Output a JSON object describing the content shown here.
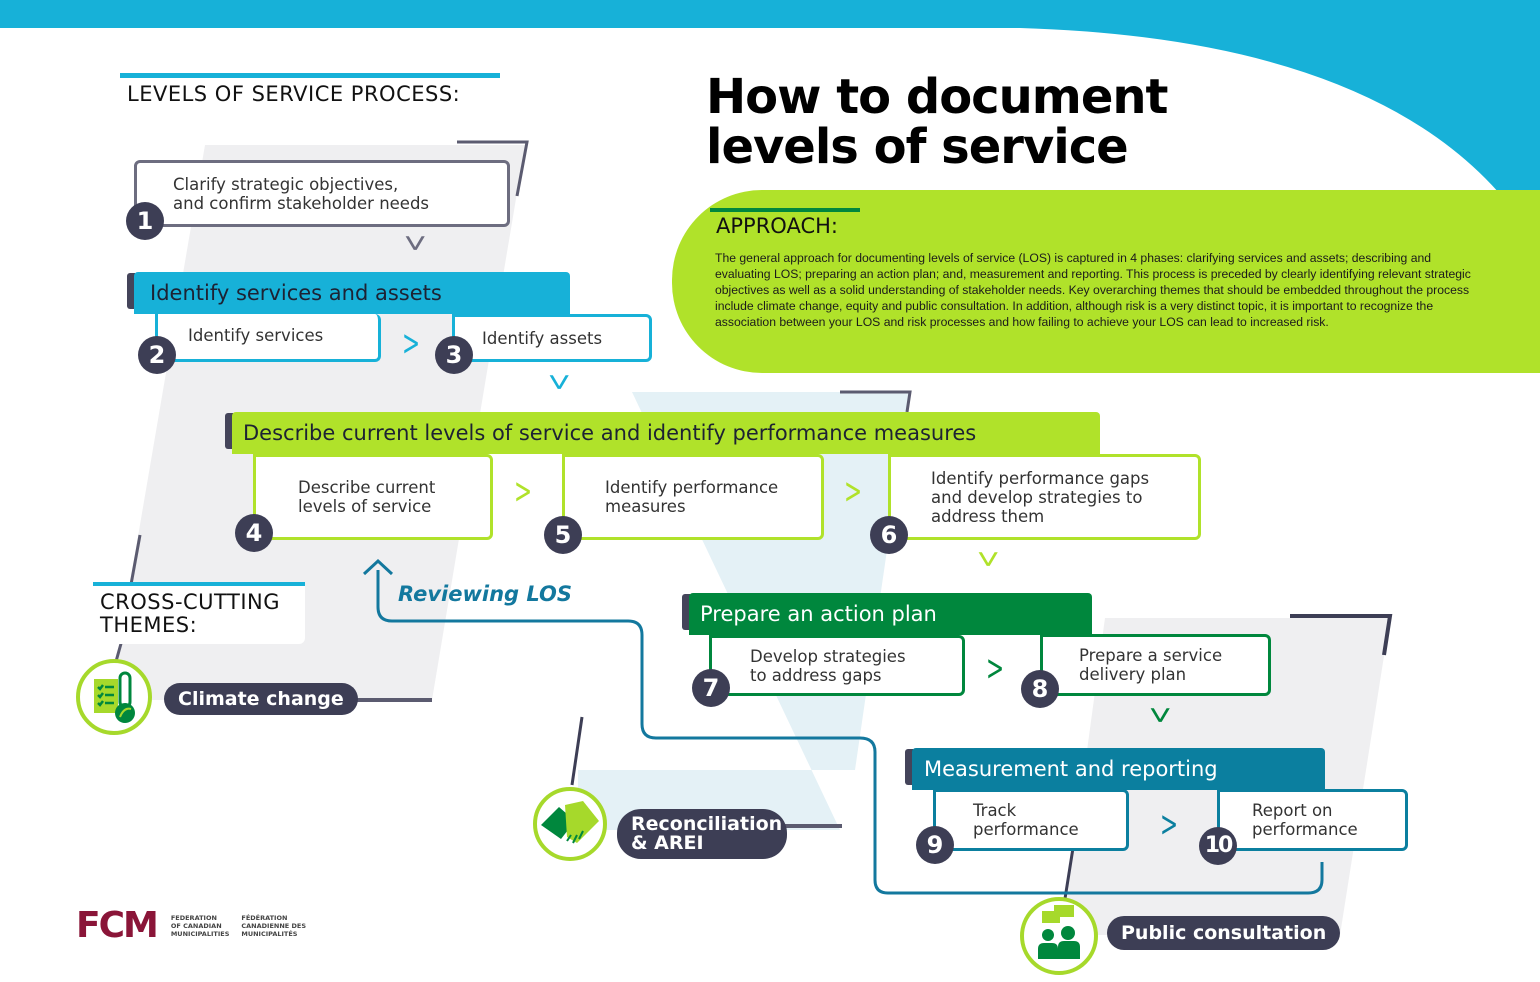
{
  "title": {
    "line1": "How to document",
    "line2": "levels of service"
  },
  "process_heading": "LEVELS OF SERVICE PROCESS:",
  "approach": {
    "heading": "APPROACH:",
    "body": "The general approach for documenting levels of service (LOS) is captured in 4 phases: clarifying services and assets; describing and evaluating LOS; preparing an action plan; and, measurement and reporting. This process is preceded by clearly identifying relevant strategic objectives as well as a solid understanding of stakeholder needs. Key overarching themes that should be embedded throughout the process include climate change, equity and public consultation. In addition, although risk is a very distinct topic, it is important to recognize the association between your LOS and risk processes and how failing to achieve your LOS can lead to increased risk."
  },
  "steps": [
    {
      "num": "1",
      "label1": "Clarify strategic objectives,",
      "label2": "and confirm stakeholder needs"
    },
    {
      "num": "2",
      "label1": "Identify services",
      "label2": ""
    },
    {
      "num": "3",
      "label1": "Identify assets",
      "label2": ""
    },
    {
      "num": "4",
      "label1": "Describe current",
      "label2": "levels of service"
    },
    {
      "num": "5",
      "label1": "Identify performance",
      "label2": "measures"
    },
    {
      "num": "6",
      "label1": "Identify performance gaps",
      "label2": "and develop strategies to",
      "label3": "address them"
    },
    {
      "num": "7",
      "label1": "Develop strategies",
      "label2": "to address gaps"
    },
    {
      "num": "8",
      "label1": "Prepare a service",
      "label2": "delivery plan"
    },
    {
      "num": "9",
      "label1": "Track",
      "label2": "performance"
    },
    {
      "num": "10",
      "label1": "Report on",
      "label2": "performance"
    }
  ],
  "phases": [
    {
      "label": "Identify services and assets",
      "color": "#17b1d8"
    },
    {
      "label": "Describe current levels of service and identify performance measures",
      "color": "#b0e22a"
    },
    {
      "label": "Prepare an action plan",
      "color": "#00873d"
    },
    {
      "label": "Measurement and reporting",
      "color": "#0b7f9f"
    }
  ],
  "reviewing_label": "Reviewing LOS",
  "cross_cutting": {
    "heading1": "CROSS-CUTTING",
    "heading2": "THEMES:",
    "themes": [
      {
        "label1": "Climate change",
        "label2": "",
        "icon": "thermometer-checklist-icon"
      },
      {
        "label1": "Reconciliation",
        "label2": "& AREI",
        "icon": "handshake-icon"
      },
      {
        "label1": "Public consultation",
        "label2": "",
        "icon": "people-speech-icon"
      }
    ]
  },
  "logo": {
    "mark": "FCM",
    "en1": "FEDERATION",
    "en2": "OF CANADIAN",
    "en3": "MUNICIPALITIES",
    "fr1": "FÉDÉRATION",
    "fr2": "CANADIENNE DES",
    "fr3": "MUNICIPALITÉS"
  },
  "colors": {
    "cyan": "#17b1d8",
    "lime": "#b0e22a",
    "green": "#00873d",
    "teal": "#0b7f9f",
    "navy": "#3d3e55",
    "maroon": "#8a1538"
  }
}
